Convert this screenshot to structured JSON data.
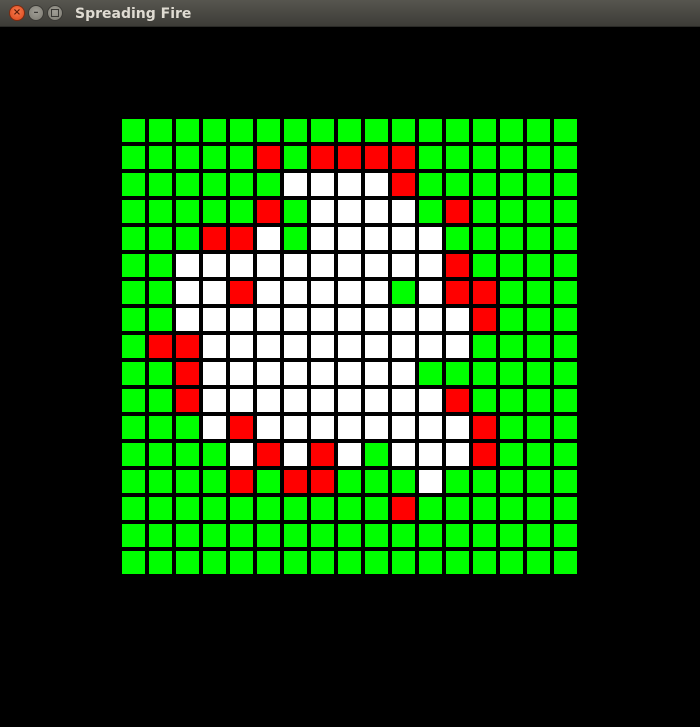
{
  "window": {
    "title": "Spreading Fire",
    "close_glyph": "×",
    "minimize_glyph": "–"
  },
  "legend": {
    "T": {
      "state": "tree",
      "color": "#00ff00"
    },
    "F": {
      "state": "burning",
      "color": "#ff0000"
    },
    "E": {
      "state": "empty",
      "color": "#ffffff"
    }
  },
  "forest": {
    "rows": 17,
    "cols": 17,
    "cells": [
      "TTTTTTTTTTTTTTTTT",
      "TTTTTFTFFFFTTTTTT",
      "TTTTTTEEEEFTTTTTT",
      "TTTTTFTEEEETFTTTT",
      "TTTFFETEEEEETTTTT",
      "TTEEEEEEEEEEFTTTT",
      "TTEEFEEEEETEFFTTT",
      "TTEEEEEEEEEEEFTTT",
      "TFFEEEEEEEEEETTTT",
      "TTFEEEEEEEETTTTTT",
      "TTFEEEEEEEEEFTTTT",
      "TTTEFEEEEEEEEFTTT",
      "TTTTEFEFETEEEFTTT",
      "TTTTFTFFTTTETTTTT",
      "TTTTTTTTTTFTTTTTT",
      "TTTTTTTTTTTTTTTTT",
      "TTTTTTTTTTTTTTTTT"
    ]
  }
}
